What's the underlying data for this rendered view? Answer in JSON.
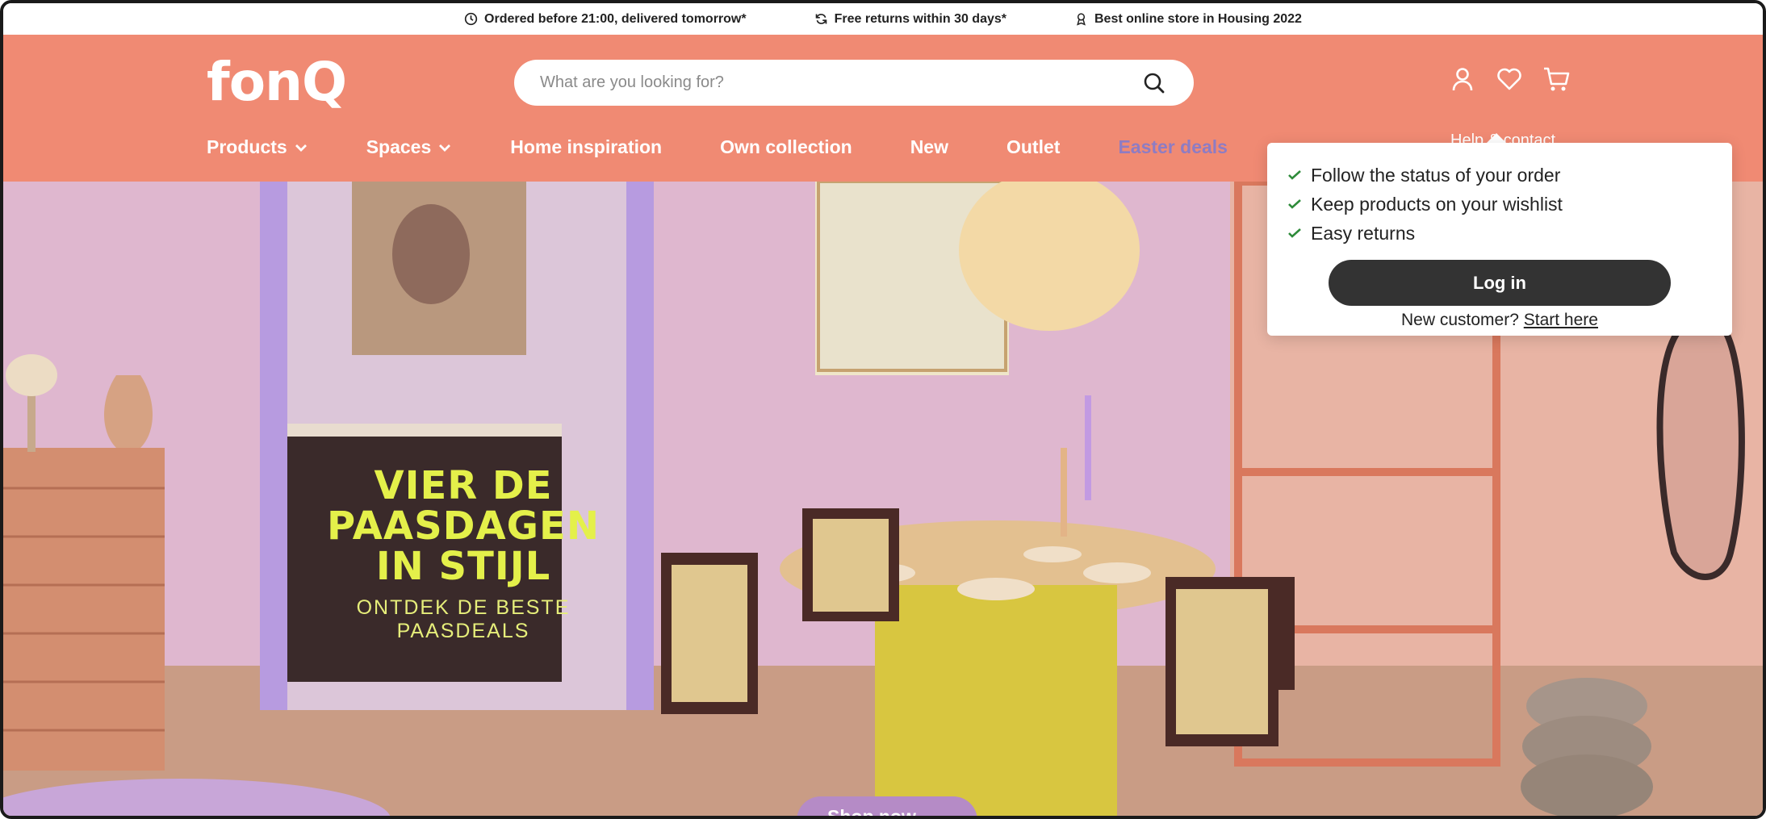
{
  "usp": [
    {
      "icon": "clock-icon",
      "text": "Ordered before 21:00, delivered tomorrow*"
    },
    {
      "icon": "refresh-icon",
      "text": "Free returns within 30 days*"
    },
    {
      "icon": "award-icon",
      "text": "Best online store in Housing 2022"
    }
  ],
  "header": {
    "logo": "fonQ",
    "search_placeholder": "What are you looking for?",
    "icons": [
      "account-icon",
      "heart-icon",
      "cart-icon"
    ]
  },
  "nav": [
    {
      "label": "Products",
      "dropdown": true
    },
    {
      "label": "Spaces",
      "dropdown": true
    },
    {
      "label": "Home inspiration",
      "dropdown": false
    },
    {
      "label": "Own collection",
      "dropdown": false
    },
    {
      "label": "New",
      "dropdown": false
    },
    {
      "label": "Outlet",
      "dropdown": false
    },
    {
      "label": "Easter deals",
      "dropdown": false,
      "color": "#8e7cc3"
    }
  ],
  "help_label": "Help & contact",
  "hero": {
    "title": "VIER DE\nPAASDAGEN\nIN STIJL",
    "subtitle": "ONTDEK DE BESTE\nPAASDEALS",
    "shop_now": "Shop now →"
  },
  "login_popup": {
    "benefits": [
      "Follow the status of your order",
      "Keep products on your wishlist",
      "Easy returns"
    ],
    "login_label": "Log in",
    "new_customer_text": "New customer?",
    "start_here_label": "Start here"
  },
  "colors": {
    "header": "#f08a73",
    "easter": "#8e7cc3",
    "hero_text": "#e4f04a",
    "login_button": "#333333",
    "check": "#2e8b3a"
  }
}
